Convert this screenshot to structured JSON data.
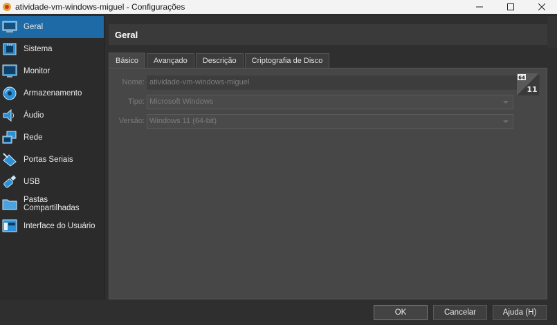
{
  "window": {
    "title": "atividade-vm-windows-miguel - Configurações",
    "controls": [
      "minimize-icon",
      "maximize-icon",
      "close-icon"
    ]
  },
  "sidebar": {
    "items": [
      {
        "label": "Geral",
        "icon": "general-icon",
        "active": true
      },
      {
        "label": "Sistema",
        "icon": "system-chip-icon"
      },
      {
        "label": "Monitor",
        "icon": "display-icon"
      },
      {
        "label": "Armazenamento",
        "icon": "storage-disc-icon"
      },
      {
        "label": "Áudio",
        "icon": "speaker-icon"
      },
      {
        "label": "Rede",
        "icon": "network-icon"
      },
      {
        "label": "Portas Seriais",
        "icon": "serial-port-icon"
      },
      {
        "label": "USB",
        "icon": "usb-icon"
      },
      {
        "label": "Pastas Compartilhadas",
        "icon": "shared-folder-icon"
      },
      {
        "label": "Interface do Usuário",
        "icon": "user-interface-icon"
      }
    ]
  },
  "section": {
    "title": "Geral"
  },
  "tabs": [
    {
      "label": "Básico",
      "active": true
    },
    {
      "label": "Avançado"
    },
    {
      "label": "Descrição"
    },
    {
      "label": "Criptografia de Disco"
    }
  ],
  "form": {
    "name_label": "Nome:",
    "name_value": "atividade-vm-windows-miguel",
    "type_label": "Tipo:",
    "type_value": "Microsoft Windows",
    "version_label": "Versão:",
    "version_value": "Windows 11 (64-bit)",
    "os_badge": {
      "top": "64",
      "bottom": "11",
      "icon": "windows-11-64bit-icon"
    }
  },
  "buttons": {
    "ok": "OK",
    "cancel": "Cancelar",
    "help": "Ajuda (H)"
  },
  "colors": {
    "accent": "#1e6aa6",
    "background": "#2f2f2f",
    "panel": "#474747"
  }
}
